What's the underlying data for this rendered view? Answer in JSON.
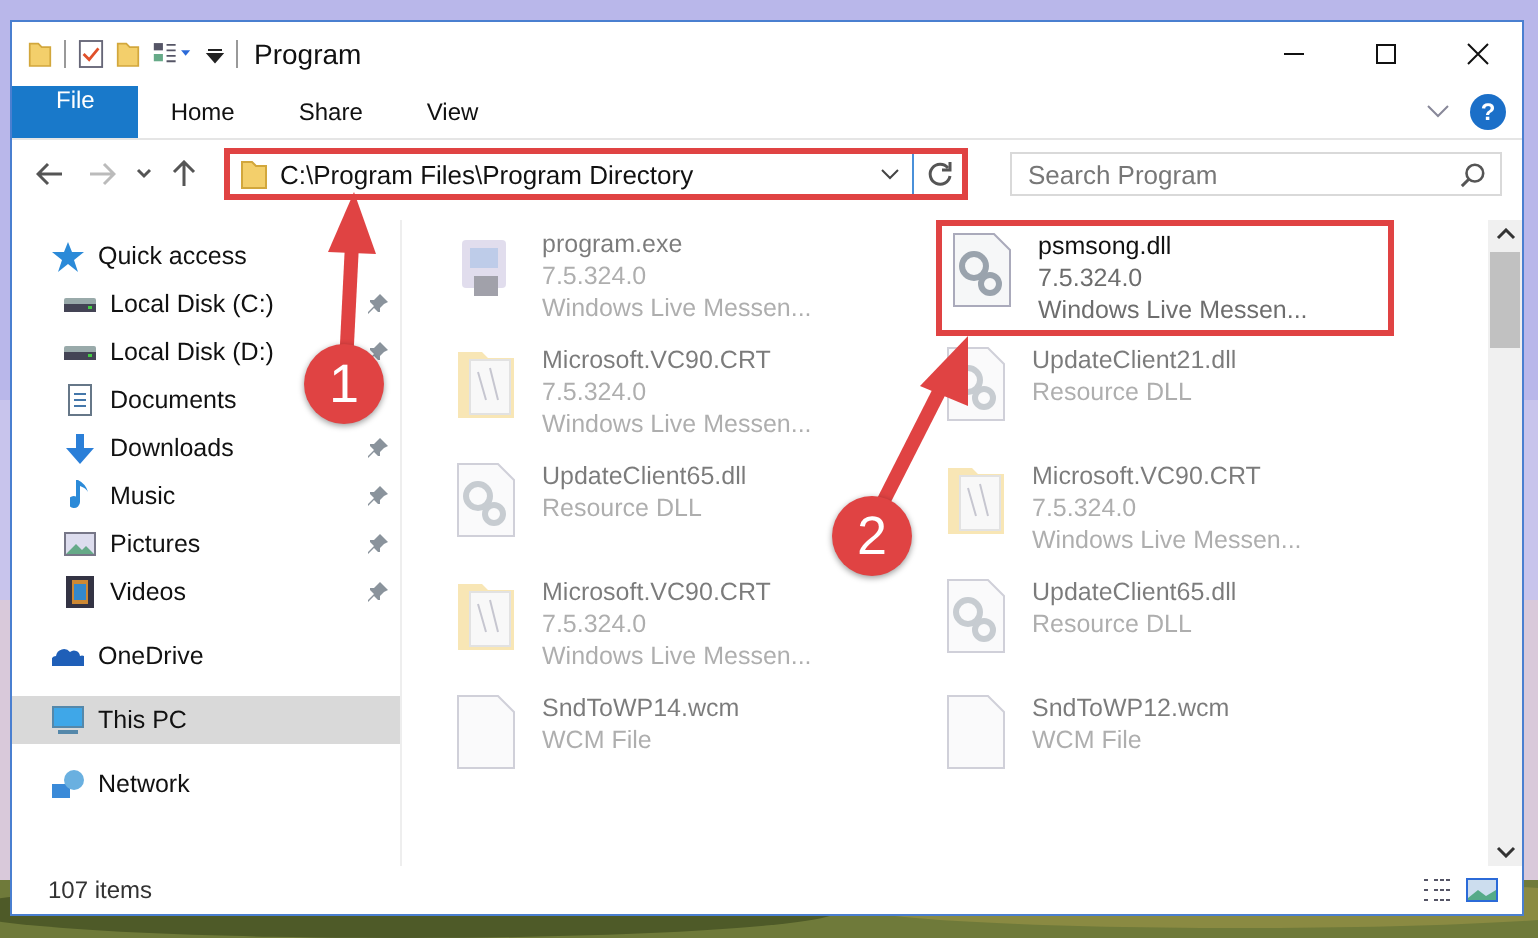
{
  "window": {
    "title": "Program"
  },
  "ribbon_tabs": [
    {
      "label": "File",
      "kind": "file"
    },
    {
      "label": "Home",
      "kind": "tab"
    },
    {
      "label": "Share",
      "kind": "tab"
    },
    {
      "label": "View",
      "kind": "tab"
    }
  ],
  "help": "?",
  "nav": {
    "forward_disabled": true
  },
  "address_bar": {
    "value": "C:\\Program Files\\Program Directory",
    "highlighted": true
  },
  "search": {
    "placeholder": "Search Program"
  },
  "sidebar": {
    "items": [
      {
        "label": "Quick access",
        "kind": "star",
        "selected": false,
        "children": [
          {
            "label": "Local Disk (C:)",
            "kind": "disk",
            "pinned": true,
            "selected": false
          },
          {
            "label": "Local Disk (D:)",
            "kind": "disk",
            "pinned": true,
            "selected": false
          },
          {
            "label": "Documents",
            "kind": "doc",
            "pinned": false,
            "selected": false
          },
          {
            "label": "Downloads",
            "kind": "download",
            "pinned": true,
            "selected": false
          },
          {
            "label": "Music",
            "kind": "music",
            "pinned": true,
            "selected": false
          },
          {
            "label": "Pictures",
            "kind": "pictures",
            "pinned": true,
            "selected": false
          },
          {
            "label": "Videos",
            "kind": "video",
            "pinned": true,
            "selected": false
          }
        ]
      },
      {
        "label": "OneDrive",
        "kind": "cloud",
        "selected": false
      },
      {
        "label": "This PC",
        "kind": "pc",
        "selected": true
      },
      {
        "label": "Network",
        "kind": "network",
        "selected": false
      }
    ]
  },
  "files": [
    {
      "name": "program.exe",
      "details": [
        "7.5.324.0",
        "Windows Live Messen..."
      ],
      "kind": "exe",
      "highlighted": false
    },
    {
      "name": "psmsong.dll",
      "details": [
        "7.5.324.0",
        "Windows Live Messen..."
      ],
      "kind": "dll",
      "highlighted": true
    },
    {
      "name": "Microsoft.VC90.CRT",
      "details": [
        "7.5.324.0",
        "Windows Live Messen..."
      ],
      "kind": "folder",
      "highlighted": false
    },
    {
      "name": "UpdateClient21.dll",
      "details": [
        "Resource DLL"
      ],
      "kind": "dll",
      "highlighted": false
    },
    {
      "name": "UpdateClient65.dll",
      "details": [
        "Resource DLL"
      ],
      "kind": "dll",
      "highlighted": false
    },
    {
      "name": "Microsoft.VC90.CRT",
      "details": [
        "7.5.324.0",
        "Windows Live Messen..."
      ],
      "kind": "folder",
      "highlighted": false
    },
    {
      "name": "Microsoft.VC90.CRT",
      "details": [
        "7.5.324.0",
        "Windows Live Messen..."
      ],
      "kind": "folder",
      "highlighted": false
    },
    {
      "name": "UpdateClient65.dll",
      "details": [
        "Resource DLL"
      ],
      "kind": "dll",
      "highlighted": false
    },
    {
      "name": "SndToWP14.wcm",
      "details": [
        "WCM File"
      ],
      "kind": "file",
      "highlighted": false
    },
    {
      "name": "SndToWP12.wcm",
      "details": [
        "WCM File"
      ],
      "kind": "file",
      "highlighted": false
    }
  ],
  "status_bar": {
    "count": "107 items"
  },
  "callouts": [
    {
      "label": "1"
    },
    {
      "label": "2"
    }
  ]
}
